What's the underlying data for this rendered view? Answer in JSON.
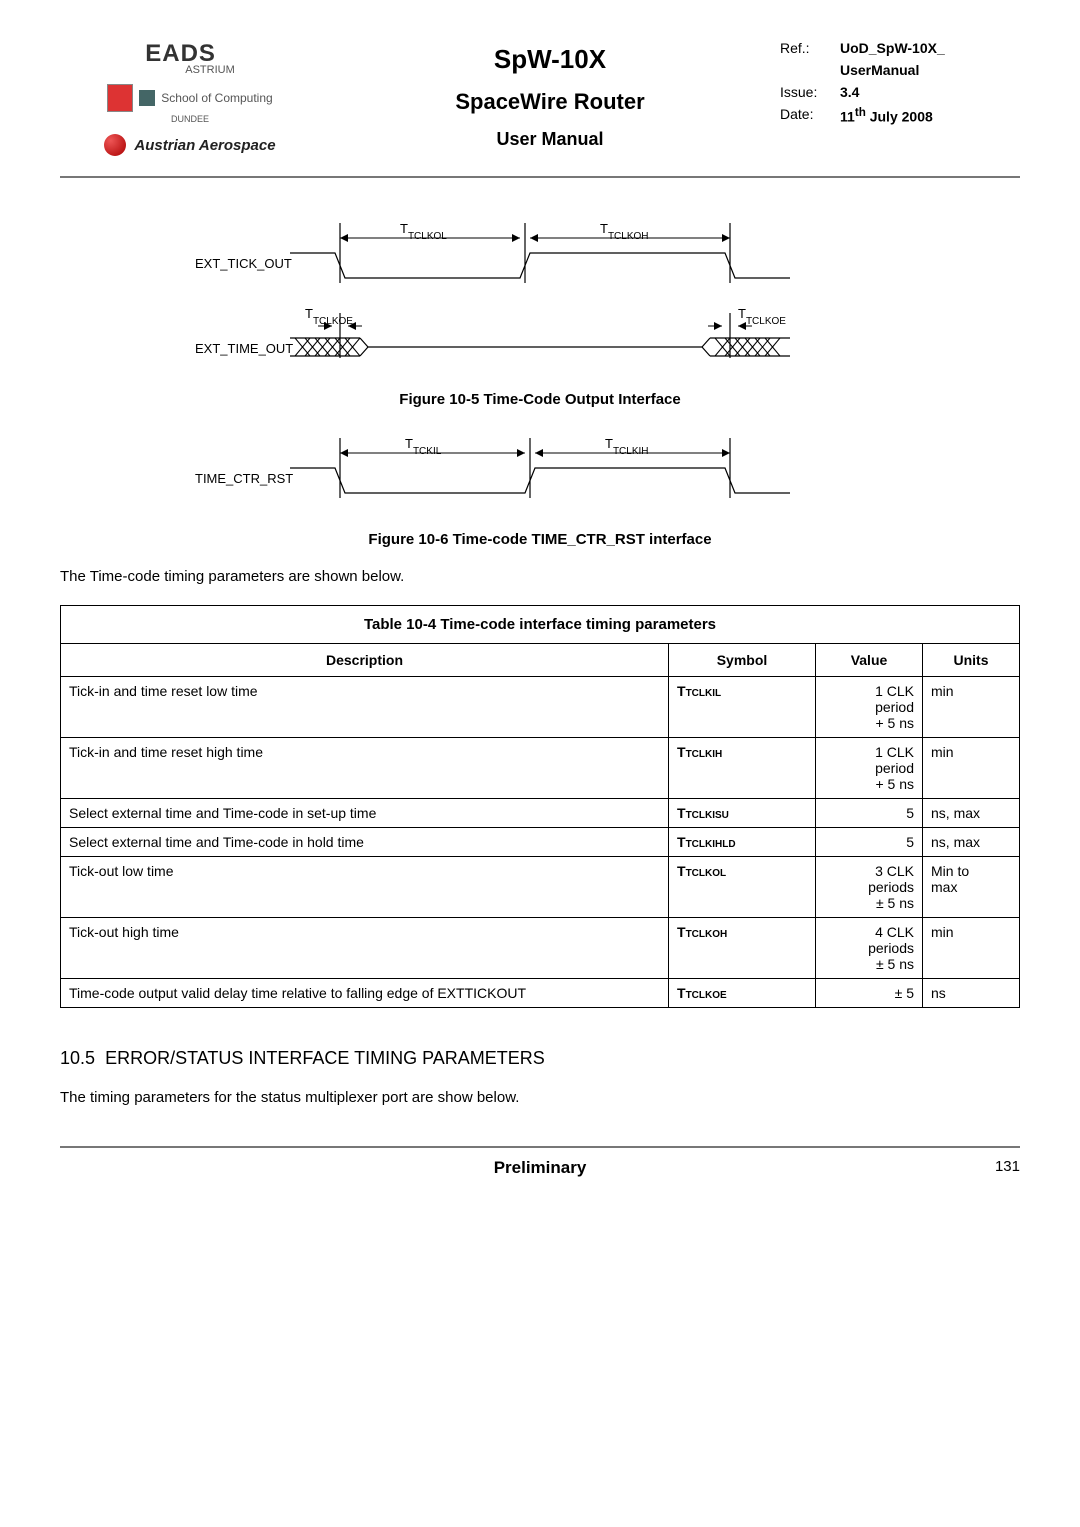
{
  "header": {
    "logo_eads": "EADS",
    "logo_astrium": "ASTRIUM",
    "school": "School of Computing",
    "dundee": "DUNDEE",
    "austrian": "Austrian Aerospace",
    "title_main": "SpW-10X",
    "title_sub": "SpaceWire Router",
    "title_sub2": "User Manual",
    "ref_label": "Ref.:",
    "ref_value": "UoD_SpW-10X_",
    "ref_value2": "UserManual",
    "issue_label": "Issue:",
    "issue_value": "3.4",
    "date_label": "Date:",
    "date_value": "11th July 2008"
  },
  "diagram1": {
    "sig1": "EXT_TICK_OUT",
    "sig2": "EXT_TIME_OUT",
    "t_tclkol": "TTCLKOL",
    "t_tclkoh": "TTCLKOH",
    "t_tclkoe": "TTCLKOE"
  },
  "caption1": "Figure 10-5 Time-Code Output Interface",
  "diagram2": {
    "sig1": "TIME_CTR_RST",
    "t_tckil": "TTCKIL",
    "t_tclkih": "TTCLKIH"
  },
  "caption2": "Figure 10-6 Time-code TIME_CTR_RST interface",
  "para1": "The Time-code timing parameters are shown below.",
  "table": {
    "caption": "Table 10-4 Time-code interface timing parameters",
    "head": {
      "desc": "Description",
      "sym": "Symbol",
      "val": "Value",
      "unit": "Units"
    },
    "rows": [
      {
        "desc": "Tick-in and time reset low time",
        "sym_base": "T",
        "sym_sub": "TCLKIL",
        "val": "1 CLK period + 5 ns",
        "unit": "min"
      },
      {
        "desc": "Tick-in and time reset high time",
        "sym_base": "T",
        "sym_sub": "TCLKIH",
        "val": "1 CLK period + 5 ns",
        "unit": "min"
      },
      {
        "desc": "Select external time and Time-code in set-up time",
        "sym_base": "T",
        "sym_sub": "TCLKISU",
        "val": "5",
        "unit": "ns, max"
      },
      {
        "desc": "Select external time and Time-code in hold time",
        "sym_base": "T",
        "sym_sub": "TCLKIHLD",
        "val": "5",
        "unit": "ns, max"
      },
      {
        "desc": "Tick-out low time",
        "sym_base": "T",
        "sym_sub": "TCLKOL",
        "val": "3 CLK periods ± 5 ns",
        "unit": "Min to max"
      },
      {
        "desc": "Tick-out high time",
        "sym_base": "T",
        "sym_sub": "TCLKOH",
        "val": "4 CLK periods ± 5 ns",
        "unit": "min"
      },
      {
        "desc": "Time-code output valid delay time relative to falling edge of EXTTICKOUT",
        "sym_base": "T",
        "sym_sub": "TCLKOE",
        "val": "± 5",
        "unit": "ns"
      }
    ]
  },
  "section": {
    "num": "10.5",
    "title": "ERROR/STATUS INTERFACE TIMING PARAMETERS"
  },
  "para2": "The timing parameters for the status multiplexer port are show below.",
  "footer": {
    "center": "Preliminary",
    "page": "131"
  },
  "chart_data": [
    {
      "type": "timing-diagram",
      "title": "Figure 10-5 Time-Code Output Interface",
      "signals": [
        "EXT_TICK_OUT",
        "EXT_TIME_OUT"
      ],
      "annotations": [
        "T_TCLKOL (low duration)",
        "T_TCLKOH (high duration)",
        "T_TCLKOE (valid delay at both edges)"
      ]
    },
    {
      "type": "timing-diagram",
      "title": "Figure 10-6 Time-code TIME_CTR_RST interface",
      "signals": [
        "TIME_CTR_RST"
      ],
      "annotations": [
        "T_TCKIL (low duration)",
        "T_TCLKIH (high duration)"
      ]
    }
  ]
}
